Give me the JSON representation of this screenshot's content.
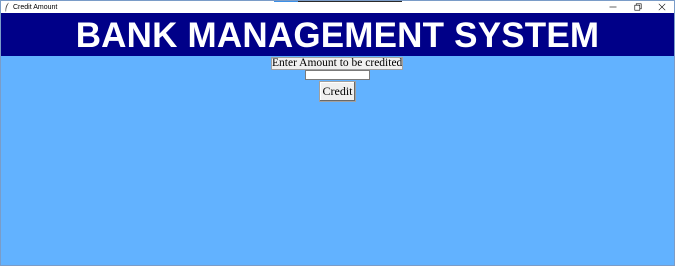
{
  "window": {
    "title": "Credit Amount",
    "icon": "feather-icon",
    "controls": [
      "minimize-icon",
      "restore-icon",
      "close-icon"
    ]
  },
  "header": {
    "banner_text": "BANK MANAGEMENT SYSTEM",
    "banner_bg": "#000088",
    "banner_fg": "#ffffff"
  },
  "form": {
    "prompt_label": "Enter Amount to be credited:",
    "amount_value": "",
    "credit_button_label": "Credit"
  },
  "colors": {
    "background": "#62b2ff",
    "button_face": "#f0f0f0"
  }
}
